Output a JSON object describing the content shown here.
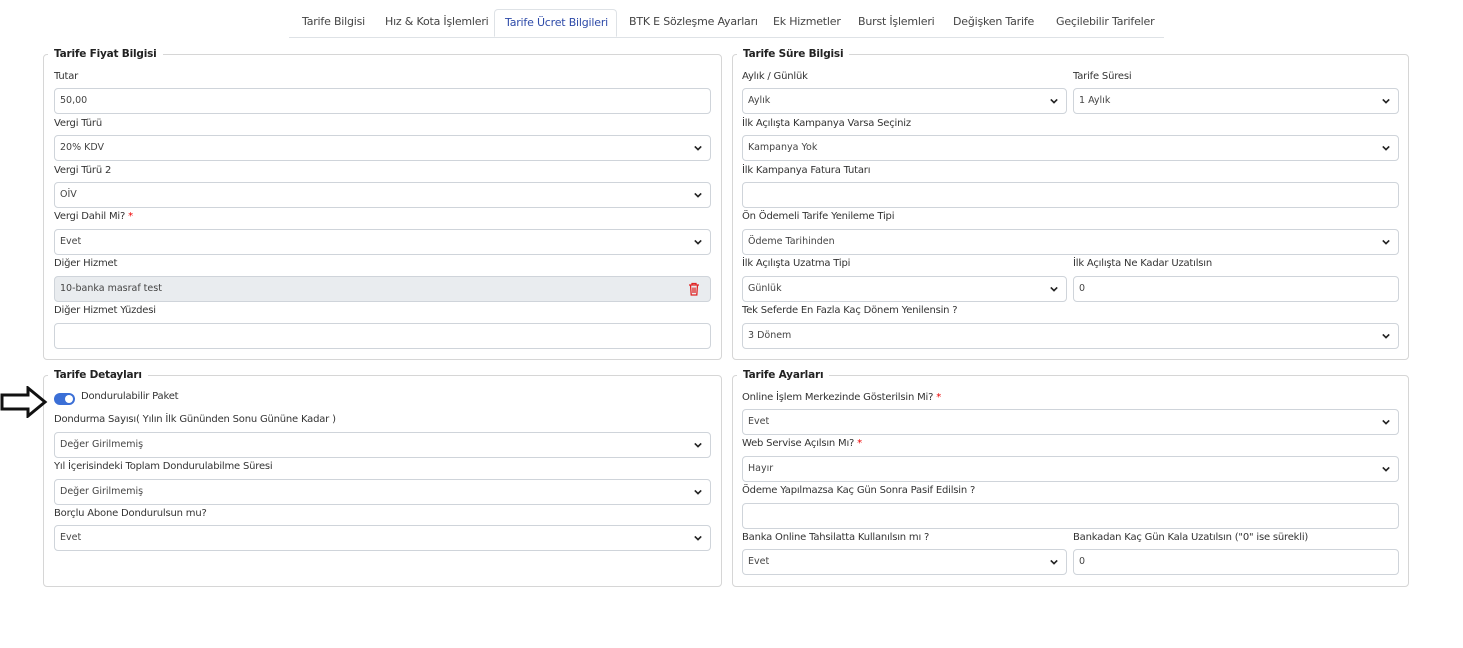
{
  "tabs": [
    {
      "label": "Tarife Bilgisi",
      "active": false
    },
    {
      "label": "Hız & Kota İşlemleri",
      "active": false
    },
    {
      "label": "Tarife Ücret Bilgileri",
      "active": true
    },
    {
      "label": "BTK E Sözleşme Ayarları",
      "active": false
    },
    {
      "label": "Ek Hizmetler",
      "active": false
    },
    {
      "label": "Burst İşlemleri",
      "active": false
    },
    {
      "label": "Değişken Tarife",
      "active": false
    },
    {
      "label": "Geçilebilir Tarifeler",
      "active": false
    }
  ],
  "fiyat": {
    "legend": "Tarife Fiyat Bilgisi",
    "tutar_label": "Tutar",
    "tutar_value": "50,00",
    "vergi_turu_label": "Vergi Türü",
    "vergi_turu_value": "20% KDV",
    "vergi_turu2_label": "Vergi Türü 2",
    "vergi_turu2_value": "OİV",
    "vergi_dahil_label": "Vergi Dahil Mi?",
    "vergi_dahil_value": "Evet",
    "diger_hizmet_label": "Diğer Hizmet",
    "diger_hizmet_value": "10-banka masraf test",
    "diger_yuzde_label": "Diğer Hizmet Yüzdesi",
    "diger_yuzde_value": ""
  },
  "sure": {
    "legend": "Tarife Süre Bilgisi",
    "aylik_label": "Aylık / Günlük",
    "aylik_value": "Aylık",
    "tarife_suresi_label": "Tarife Süresi",
    "tarife_suresi_value": "1 Aylık",
    "kampanya_label": "İlk Açılışta Kampanya Varsa Seçiniz",
    "kampanya_value": "Kampanya Yok",
    "fatura_label": "İlk Kampanya Fatura Tutarı",
    "fatura_value": "",
    "yenileme_label": "Ön Ödemeli Tarife Yenileme Tipi",
    "yenileme_value": "Ödeme Tarihinden",
    "uzatma_tipi_label": "İlk Açılışta Uzatma Tipi",
    "uzatma_tipi_value": "Günlük",
    "uzatma_kadar_label": "İlk Açılışta Ne Kadar Uzatılsın",
    "uzatma_kadar_value": "0",
    "donem_label": "Tek Seferde En Fazla Kaç Dönem Yenilensin ?",
    "donem_value": "3 Dönem"
  },
  "detay": {
    "legend": "Tarife Detayları",
    "dondurulabilir_label": "Dondurulabilir Paket",
    "dondurulabilir_on": true,
    "dondurma_sayisi_label": "Dondurma Sayısı( Yılın İlk Gününden Sonu Gününe Kadar )",
    "dondurma_sayisi_value": "Değer Girilmemiş",
    "toplam_label": "Yıl İçerisindeki Toplam Dondurulabilme Süresi",
    "toplam_value": "Değer Girilmemiş",
    "borclu_label": "Borçlu Abone Dondurulsun mu?",
    "borclu_value": "Evet"
  },
  "ayarlar": {
    "legend": "Tarife Ayarları",
    "online_label": "Online İşlem Merkezinde Gösterilsin Mi?",
    "online_value": "Evet",
    "web_label": "Web Servise Açılsın Mı?",
    "web_value": "Hayır",
    "odeme_label": "Ödeme Yapılmazsa Kaç Gün Sonra Pasif Edilsin ?",
    "odeme_value": "",
    "banka_label": "Banka Online Tahsilatta Kullanılsın mı ?",
    "banka_value": "Evet",
    "bankadan_label": "Bankadan Kaç Gün Kala Uzatılsın (\"0\" ise sürekli)",
    "bankadan_value": "0"
  },
  "required_mark": "*"
}
